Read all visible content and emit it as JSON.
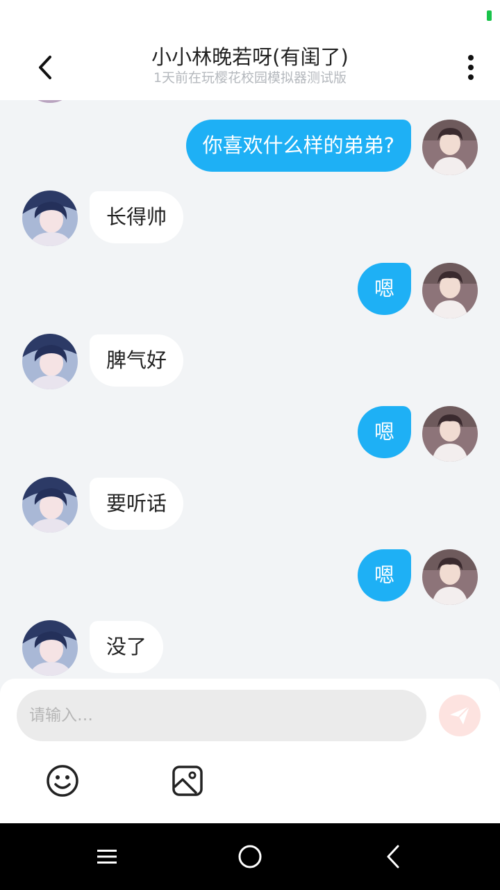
{
  "header": {
    "title": "小小林晚若呀(有闺了)",
    "subtitle": "1天前在玩樱花校园模拟器测试版",
    "back_icon": "chevron-left-icon",
    "more_icon": "more-vertical-icon"
  },
  "messages": [
    {
      "sender": "me",
      "text": "你喜欢什么样的弟弟?"
    },
    {
      "sender": "other",
      "text": "长得帅"
    },
    {
      "sender": "me",
      "text": "嗯"
    },
    {
      "sender": "other",
      "text": "脾气好"
    },
    {
      "sender": "me",
      "text": "嗯"
    },
    {
      "sender": "other",
      "text": "要听话"
    },
    {
      "sender": "me",
      "text": "嗯"
    },
    {
      "sender": "other",
      "text": "没了"
    }
  ],
  "composer": {
    "placeholder": "请输入…",
    "send_icon": "paper-plane-icon",
    "emoji_icon": "smiley-icon",
    "image_icon": "image-icon"
  },
  "nav": {
    "menu_icon": "menu-icon",
    "home_icon": "home-circle-icon",
    "back_icon": "back-triangle-icon"
  },
  "colors": {
    "my_bubble": "#1eb0f5",
    "their_bubble": "#ffffff",
    "chat_background": "#f2f4f6",
    "send_button": "#fde3e0",
    "battery": "#19c34a"
  }
}
